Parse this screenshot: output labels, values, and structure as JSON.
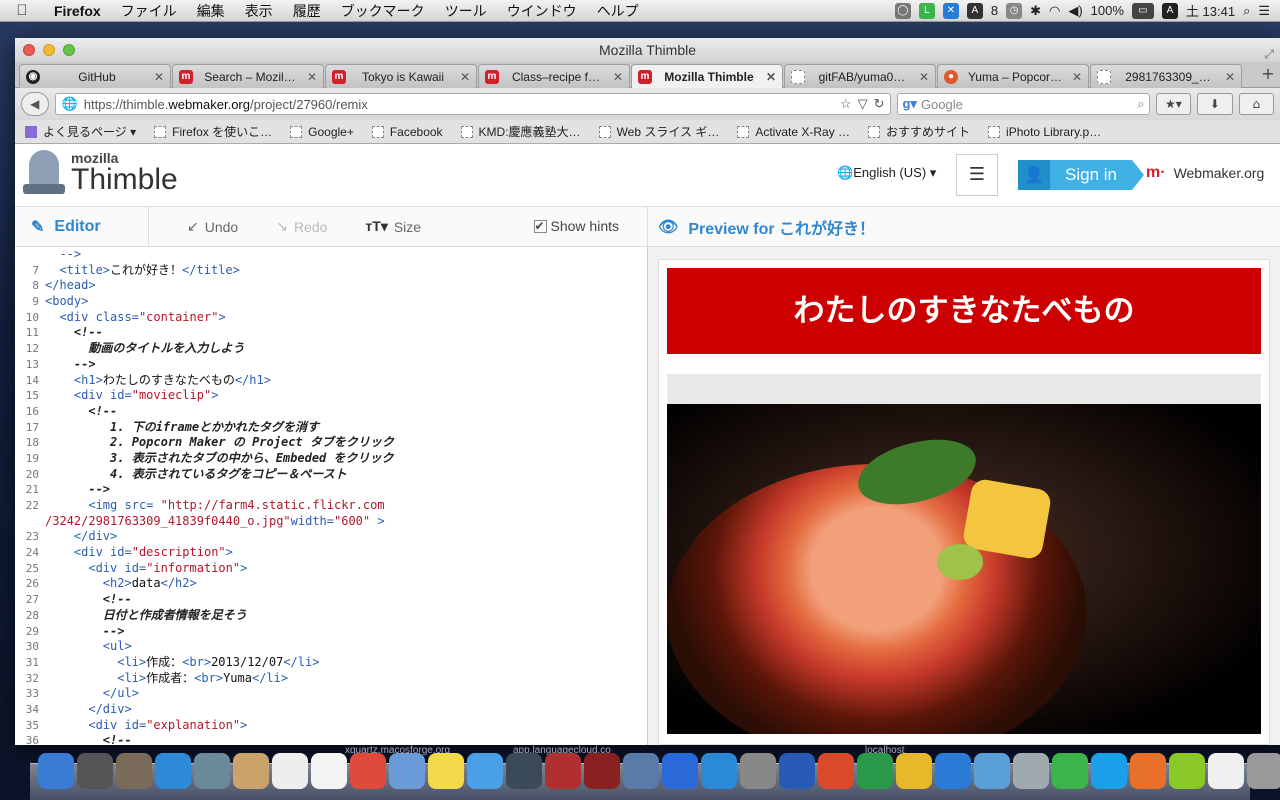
{
  "menubar": {
    "apple": "",
    "app": "Firefox",
    "items": [
      "ファイル",
      "編集",
      "表示",
      "履歴",
      "ブックマーク",
      "ツール",
      "ウインドウ",
      "ヘルプ"
    ],
    "status": {
      "number": "8",
      "battery": "100%",
      "input": "A",
      "clock": "土 13:41"
    }
  },
  "window": {
    "title": "Mozilla Thimble",
    "tabs": [
      {
        "label": "GitHub",
        "icon": "github-icon"
      },
      {
        "label": "Search – Mozil…",
        "icon": "m"
      },
      {
        "label": "Tokyo is Kawaii",
        "icon": "m"
      },
      {
        "label": "Class–recipe f…",
        "icon": "m"
      },
      {
        "label": "Mozilla Thimble",
        "icon": "m"
      },
      {
        "label": "gitFAB/yuma0…",
        "icon": "blank"
      },
      {
        "label": "Yuma – Popcor…",
        "icon": "yuma"
      },
      {
        "label": "2981763309_…",
        "icon": "blank"
      }
    ],
    "url_prefix": "https://thimble.",
    "url_domain": "webmaker.org",
    "url_path": "/project/27960/remix",
    "search_placeholder": "Google",
    "bookmarks": [
      "よく見るページ ▾",
      "Firefox を使いこ…",
      "Google+",
      "Facebook",
      "KMD:慶應義塾大…",
      "Web スライス ギ…",
      "Activate X-Ray …",
      "おすすめサイト",
      "iPhoto Library.p…"
    ]
  },
  "thimble": {
    "logo_small": "mozilla",
    "logo_big": "Thimble",
    "language": "English (US) ▾",
    "signin": "Sign in",
    "webmaker": "Webmaker.org",
    "editor_label": "Editor",
    "undo": "Undo",
    "redo": "Redo",
    "size": "Size",
    "hints": "Show hints",
    "preview_label": "Preview for これが好き！"
  },
  "code_lines": [
    {
      "n": "",
      "html": "<span class='tag'>  --></span>"
    },
    {
      "n": "7",
      "html": "  <span class='tag'>&lt;title&gt;</span>これが好き！<span class='tag'>&lt;/title&gt;</span>"
    },
    {
      "n": "8",
      "html": "<span class='tag'>&lt;/head&gt;</span>"
    },
    {
      "n": "9",
      "html": "<span class='tag'>&lt;body&gt;</span>"
    },
    {
      "n": "10",
      "html": "  <span class='tag'>&lt;div</span> <span class='attr'>class=</span><span class='str'>\"container\"</span><span class='tag'>&gt;</span>"
    },
    {
      "n": "11",
      "html": "    <span class='cm'>&lt;!--</span>"
    },
    {
      "n": "12",
      "html": "      <span class='cm'>動画のタイトルを入力しよう</span>"
    },
    {
      "n": "13",
      "html": "    <span class='cm'>--&gt;</span>"
    },
    {
      "n": "14",
      "html": "    <span class='tag'>&lt;h1&gt;</span>わたしのすきなたべもの<span class='tag'>&lt;/h1&gt;</span>"
    },
    {
      "n": "15",
      "html": "    <span class='tag'>&lt;div</span> <span class='attr'>id=</span><span class='str'>\"movieclip\"</span><span class='tag'>&gt;</span>"
    },
    {
      "n": "16",
      "html": "      <span class='cm'>&lt;!--</span>"
    },
    {
      "n": "17",
      "html": "         <span class='cm'>1. 下のiframeとかかれたタグを消す</span>"
    },
    {
      "n": "18",
      "html": "         <span class='cm'>2. Popcorn Maker の Project タブをクリック</span>"
    },
    {
      "n": "19",
      "html": "         <span class='cm'>3. 表示されたタブの中から、Embeded をクリック</span>"
    },
    {
      "n": "20",
      "html": "         <span class='cm'>4. 表示されているタグをコピー＆ペースト</span>"
    },
    {
      "n": "21",
      "html": "      <span class='cm'>--&gt;</span>"
    },
    {
      "n": "22",
      "html": "      <span class='tag'>&lt;img</span> <span class='attr'>src=</span> <span class='str'>\"http://farm4.static.flickr.com</span>"
    },
    {
      "n": "",
      "html": "<span class='str'>/3242/2981763309_41839f0440_o.jpg\"</span><span class='attr'>width=</span><span class='str'>\"600\"</span> <span class='tag'>&gt;</span>"
    },
    {
      "n": "23",
      "html": "    <span class='tag'>&lt;/div&gt;</span>"
    },
    {
      "n": "24",
      "html": "    <span class='tag'>&lt;div</span> <span class='attr'>id=</span><span class='str'>\"description\"</span><span class='tag'>&gt;</span>"
    },
    {
      "n": "25",
      "html": "      <span class='tag'>&lt;div</span> <span class='attr'>id=</span><span class='str'>\"information\"</span><span class='tag'>&gt;</span>"
    },
    {
      "n": "26",
      "html": "        <span class='tag'>&lt;h2&gt;</span>data<span class='tag'>&lt;/h2&gt;</span>"
    },
    {
      "n": "27",
      "html": "        <span class='cm'>&lt;!--</span>"
    },
    {
      "n": "28",
      "html": "        <span class='cm'>日付と作成者情報を足そう</span>"
    },
    {
      "n": "29",
      "html": "        <span class='cm'>--&gt;</span>"
    },
    {
      "n": "30",
      "html": "        <span class='tag'>&lt;ul&gt;</span>"
    },
    {
      "n": "31",
      "html": "          <span class='tag'>&lt;li&gt;</span>作成：<span class='tag'>&lt;br&gt;</span>2013/12/07<span class='tag'>&lt;/li&gt;</span>"
    },
    {
      "n": "32",
      "html": "          <span class='tag'>&lt;li&gt;</span>作成者：<span class='tag'>&lt;br&gt;</span>Yuma<span class='tag'>&lt;/li&gt;</span>"
    },
    {
      "n": "33",
      "html": "        <span class='tag'>&lt;/ul&gt;</span>"
    },
    {
      "n": "34",
      "html": "      <span class='tag'>&lt;/div&gt;</span>"
    },
    {
      "n": "35",
      "html": "      <span class='tag'>&lt;div</span> <span class='attr'>id=</span><span class='str'>\"explanation\"</span><span class='tag'>&gt;</span>"
    },
    {
      "n": "36",
      "html": "        <span class='cm'>&lt;!--</span>"
    }
  ],
  "preview": {
    "heading": "わたしのすきなたべもの"
  },
  "dock": {
    "labels": [
      "xquartz.macosforge.org",
      "app.languagecloud.co",
      "localhost"
    ],
    "icons": [
      "finder-icon",
      "launchpad-icon",
      "mission-control-icon",
      "safari-icon",
      "mail-bird-icon",
      "address-book-icon",
      "calendar-icon",
      "reminders-icon",
      "chrome-icon",
      "iphoto-icon",
      "stickies-icon",
      "messages-icon",
      "facetime-icon",
      "photo-booth-icon",
      "movies-icon",
      "preview-icon",
      "itunes-icon",
      "app-store-icon",
      "system-preferences-icon",
      "word-icon",
      "powerpoint-icon",
      "excel-icon",
      "outlook-icon",
      "lync-icon",
      "network-icon",
      "remote-desktop-icon",
      "line-icon",
      "skype-icon",
      "firefox-icon",
      "lime-icon",
      "document-icon",
      "trash-icon"
    ]
  }
}
